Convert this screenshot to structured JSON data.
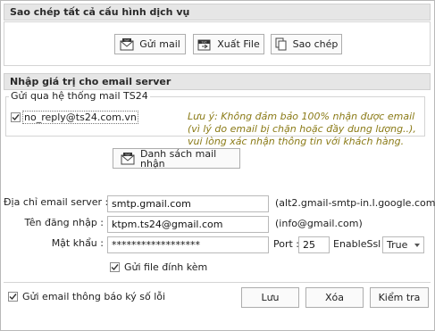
{
  "copy_section": {
    "title": "Sao chép tất cả cấu hình dịch vụ",
    "send_mail_label": "Gửi mail",
    "export_file_label": "Xuất File",
    "copy_label": "Sao chép"
  },
  "server_section": {
    "title": "Nhập giá trị cho email server",
    "group_title": "Gửi qua hệ thống mail TS24",
    "system_account": "no_reply@ts24.com.vn",
    "system_account_checked": true,
    "note": [
      "Lưu ý: Không đảm bảo 100% nhận được email",
      "(vì lý do email bị chặn hoặc đầy dung lượng..),",
      "vui lòng xác nhận thông tin với khách hàng."
    ]
  },
  "recipients_button_label": "Danh sách mail nhận",
  "form": {
    "server_label": "Địa chỉ email server :",
    "server_value": "smtp.gmail.com",
    "server_hint": "(alt2.gmail-smtp-in.l.google.com)",
    "username_label": "Tên đăng nhập :",
    "username_value": "ktpm.ts24@gmail.com",
    "username_hint": "(info@gmail.com)",
    "password_label": "Mật khẩu :",
    "password_value": "******************",
    "port_label": "Port :",
    "port_value": "25",
    "ssl_label": "EnableSsl :",
    "ssl_value": "True",
    "attach_label": "Gửi file đính kèm",
    "attach_checked": true
  },
  "footer": {
    "notify_label": "Gửi email thông báo ký số lỗi",
    "notify_checked": true,
    "save_label": "Lưu",
    "delete_label": "Xóa",
    "check_label": "Kiểm tra"
  },
  "colors": {
    "note_text": "#8a7a16",
    "header_bg": "#e6e6e6",
    "border": "#b9b9b9"
  }
}
